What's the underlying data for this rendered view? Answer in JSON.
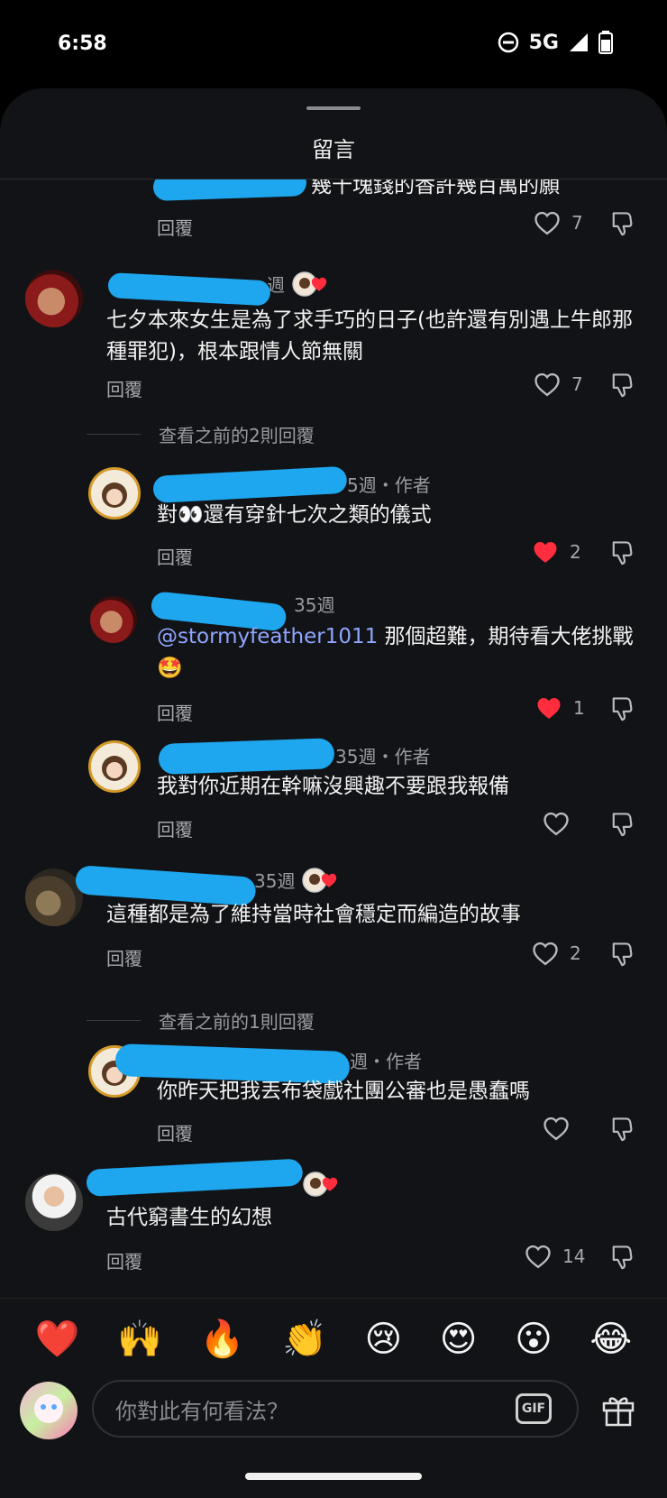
{
  "status_bar": {
    "time": "6:58",
    "network": "5G",
    "icons": [
      "do-not-disturb-icon",
      "signal-icon",
      "battery-icon"
    ]
  },
  "sheet": {
    "title": "留言"
  },
  "comments": [
    {
      "id": "c0",
      "body": "幾十塊錢的香許幾百萬的願",
      "reply": "回覆",
      "likes": "7",
      "liked": false
    },
    {
      "id": "c1",
      "name_suffix": "週",
      "body": "七夕本來女生是為了求手巧的日子(也許還有別遇上牛郎那種罪犯)，根本跟情人節無關",
      "reply": "回覆",
      "likes": "7",
      "liked": false
    },
    {
      "id": "r1",
      "meta": "5週・作者",
      "body": "對👀還有穿針七次之類的儀式",
      "reply": "回覆",
      "likes": "2",
      "liked": true
    },
    {
      "id": "r2",
      "meta": "35週",
      "mention": "@stormyfeather1011",
      "body": " 那個超難，期待看大佬挑戰🤩",
      "reply": "回覆",
      "likes": "1",
      "liked": true
    },
    {
      "id": "r3",
      "meta": "35週・作者",
      "body": "我對你近期在幹嘛沒興趣不要跟我報備",
      "reply": "回覆",
      "likes": "",
      "liked": false
    },
    {
      "id": "c2",
      "meta": "35週",
      "body": "這種都是為了維持當時社會穩定而編造的故事",
      "reply": "回覆",
      "likes": "2",
      "liked": false
    },
    {
      "id": "r4",
      "meta": "週・作者",
      "body": "你昨天把我丟布袋戲社團公審也是愚蠢嗎",
      "reply": "回覆",
      "likes": "",
      "liked": false
    },
    {
      "id": "c3",
      "body": "古代窮書生的幻想",
      "reply": "回覆",
      "likes": "14",
      "liked": false
    }
  ],
  "view_previous": [
    "查看之前的2則回覆",
    "查看之前的1則回覆"
  ],
  "emoji_bar": [
    "❤️",
    "🙌",
    "🔥",
    "👏",
    "😢",
    "😍",
    "😮",
    "😂"
  ],
  "composer": {
    "placeholder": "你對此有何看法？",
    "gif_label": "GIF"
  }
}
